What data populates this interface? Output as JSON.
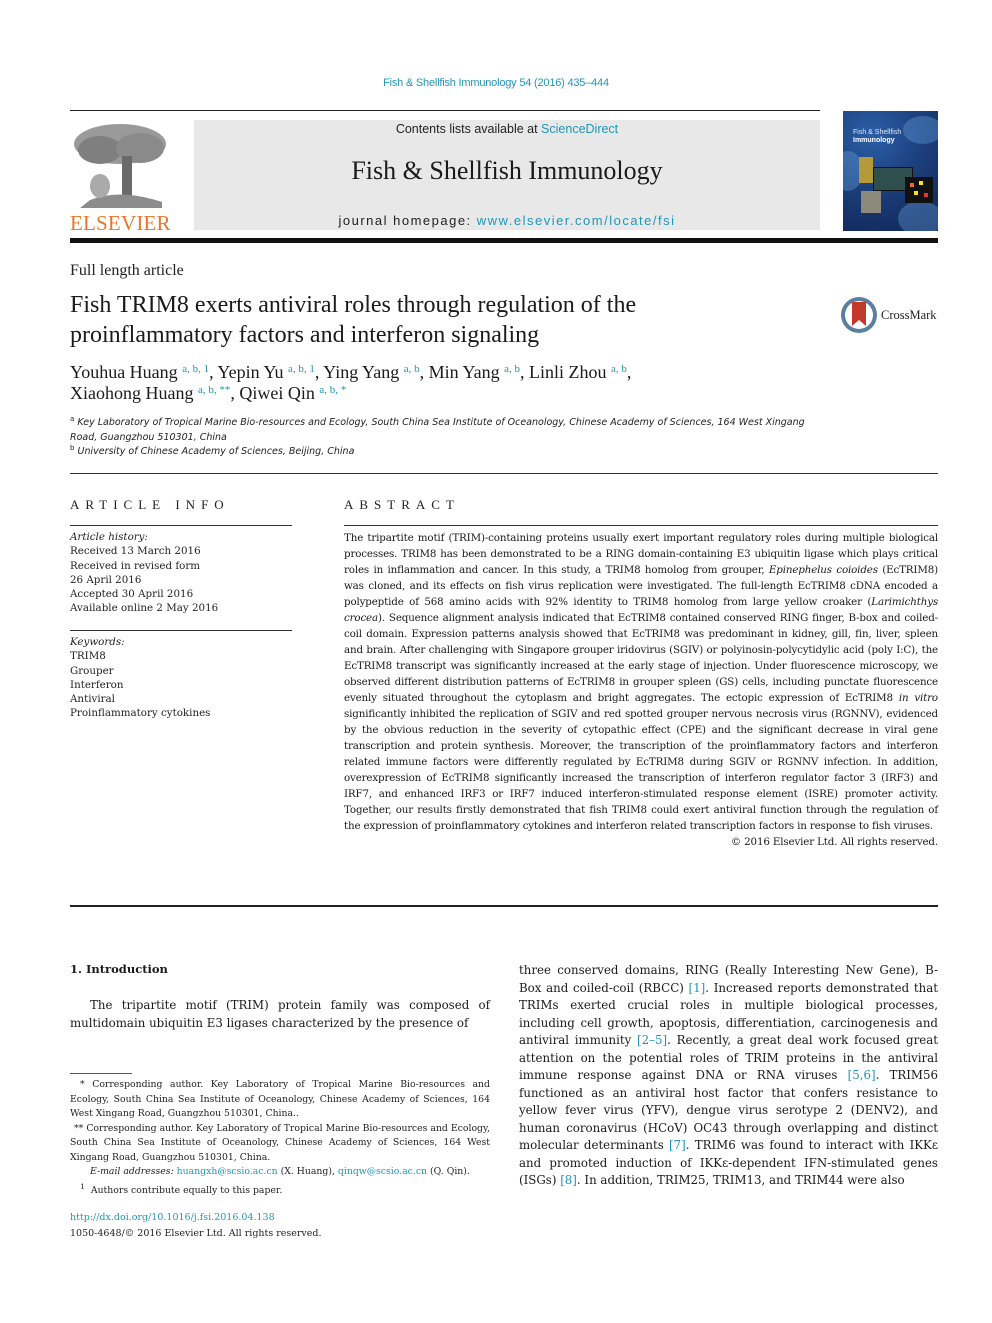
{
  "running_head": "Fish & Shellfish Immunology 54 (2016) 435–444",
  "masthead": {
    "contents_prefix": "Contents lists available at ",
    "contents_link": "ScienceDirect",
    "journal_title": "Fish & Shellfish Immunology",
    "homepage_prefix": "journal homepage: ",
    "homepage_link": "www.elsevier.com/locate/fsi",
    "publisher_logo": "ELSEVIER",
    "cover_title_line1": "Fish & Shellfish",
    "cover_title_line2": "Immunology"
  },
  "article": {
    "type": "Full length article",
    "title": "Fish TRIM8 exerts antiviral roles through regulation of the proinflammatory factors and interferon signaling",
    "crossmark_label": "CrossMark",
    "authors": [
      {
        "name": "Youhua Huang",
        "sup": "a, b, 1",
        "sep": ", "
      },
      {
        "name": "Yepin Yu",
        "sup": "a, b, 1",
        "sep": ", "
      },
      {
        "name": "Ying Yang",
        "sup": "a, b",
        "sep": ", "
      },
      {
        "name": "Min Yang",
        "sup": "a, b",
        "sep": ", "
      },
      {
        "name": "Linli Zhou",
        "sup": "a, b",
        "sep": ","
      },
      {
        "name": "Xiaohong Huang",
        "sup": "a, b, **",
        "sep": ", "
      },
      {
        "name": "Qiwei Qin",
        "sup": "a, b, *",
        "sep": ""
      }
    ],
    "affiliations": [
      {
        "mark": "a",
        "text": "Key Laboratory of Tropical Marine Bio-resources and Ecology, South China Sea Institute of Oceanology, Chinese Academy of Sciences, 164 West Xingang Road, Guangzhou 510301, China"
      },
      {
        "mark": "b",
        "text": "University of Chinese Academy of Sciences, Beijing, China"
      }
    ]
  },
  "article_info": {
    "heading": "ARTICLE INFO",
    "history_label": "Article history:",
    "history": [
      "Received 13 March 2016",
      "Received in revised form",
      "26 April 2016",
      "Accepted 30 April 2016",
      "Available online 2 May 2016"
    ],
    "keywords_label": "Keywords:",
    "keywords": [
      "TRIM8",
      "Grouper",
      "Interferon",
      "Antiviral",
      "Proinflammatory cytokines"
    ]
  },
  "abstract": {
    "heading": "ABSTRACT",
    "parts": [
      "The tripartite motif (TRIM)-containing proteins usually exert important regulatory roles during multiple biological processes. TRIM8 has been demonstrated to be a RING domain-containing E3 ubiquitin ligase which plays critical roles in inflammation and cancer. In this study, a TRIM8 homolog from grouper, ",
      "Epinephelus coioides",
      " (EcTRIM8) was cloned, and its effects on fish virus replication were investigated. The full-length EcTRIM8 cDNA encoded a polypeptide of 568 amino acids with 92% identity to TRIM8 homolog from large yellow croaker (",
      "Larimichthys crocea",
      "). Sequence alignment analysis indicated that EcTRIM8 contained conserved RING finger, B-box and coiled-coil domain. Expression patterns analysis showed that EcTRIM8 was predominant in kidney, gill, fin, liver, spleen and brain. After challenging with Singapore grouper iridovirus (SGIV) or polyinosin-polycytidylic acid (poly I:C), the EcTRIM8 transcript was significantly increased at the early stage of injection. Under fluorescence microscopy, we observed different distribution patterns of EcTRIM8 in grouper spleen (GS) cells, including punctate fluorescence evenly situated throughout the cytoplasm and bright aggregates. The ectopic expression of EcTRIM8 ",
      "in vitro",
      " significantly inhibited the replication of SGIV and red spotted grouper nervous necrosis virus (RGNNV), evidenced by the obvious reduction in the severity of cytopathic effect (CPE) and the significant decrease in viral gene transcription and protein synthesis. Moreover, the transcription of the proinflammatory factors and interferon related immune factors were differently regulated by EcTRIM8 during SGIV or RGNNV infection. In addition, overexpression of EcTRIM8 significantly increased the transcription of interferon regulator factor 3 (IRF3) and IRF7, and enhanced IRF3 or IRF7 induced interferon-stimulated response element (ISRE) promoter activity. Together, our results firstly demonstrated that fish TRIM8 could exert antiviral function through the regulation of the expression of proinflammatory cytokines and interferon related transcription factors in response to fish viruses."
    ],
    "rights": "© 2016 Elsevier Ltd. All rights reserved."
  },
  "introduction": {
    "heading": "1.  Introduction",
    "para1": "The tripartite motif (TRIM) protein family was composed of multidomain ubiquitin E3 ligases characterized by the presence of",
    "col2": [
      {
        "t": "three conserved domains, RING (Really Interesting New Gene), B-Box and coiled-coil (RBCC) "
      },
      {
        "ref": "[1]"
      },
      {
        "t": ". Increased reports demonstrated that TRIMs exerted crucial roles in multiple biological processes, including cell growth, apoptosis, differentiation, carcinogenesis and antiviral immunity "
      },
      {
        "ref": "[2–5]"
      },
      {
        "t": ". Recently, a great deal work focused great attention on the potential roles of TRIM proteins in the antiviral immune response against DNA or RNA viruses "
      },
      {
        "ref": "[5,6]"
      },
      {
        "t": ". TRIM56 functioned as an antiviral host factor that confers resistance to yellow fever virus (YFV), dengue virus serotype 2 (DENV2), and human coronavirus (HCoV) OC43 through overlapping and distinct molecular determinants "
      },
      {
        "ref": "[7]"
      },
      {
        "t": ". TRIM6 was found to interact with IKKε and promoted induction of IKKε-dependent IFN-stimulated genes (ISGs) "
      },
      {
        "ref": "[8]"
      },
      {
        "t": ". In addition, TRIM25, TRIM13, and TRIM44 were also"
      }
    ]
  },
  "footnotes": {
    "corr1": "* Corresponding author. Key Laboratory of Tropical Marine Bio-resources and Ecology, South China Sea Institute of Oceanology, Chinese Academy of Sciences, 164 West Xingang Road, Guangzhou 510301, China..",
    "corr2": "** Corresponding author. Key Laboratory of Tropical Marine Bio-resources and Ecology, South China Sea Institute of Oceanology, Chinese Academy of Sciences, 164 West Xingang Road, Guangzhou 510301, China.",
    "email_label": "E-mail addresses:",
    "email1": "huangxh@scsio.ac.cn",
    "email1_who": " (X. Huang), ",
    "email2": "qinqw@scsio.ac.cn",
    "email2_who": " (Q. Qin).",
    "equal_mark": "1",
    "equal_text": "Authors contribute equally to this paper."
  },
  "doi": {
    "link": "http://dx.doi.org/10.1016/j.fsi.2016.04.138",
    "issn_rights": "1050-4648/© 2016 Elsevier Ltd. All rights reserved."
  },
  "colors": {
    "link": "#2196b7",
    "elsevier_orange": "#e8762b",
    "masthead_bg": "#e8e8e8",
    "crossmark_red": "#c0392b"
  }
}
